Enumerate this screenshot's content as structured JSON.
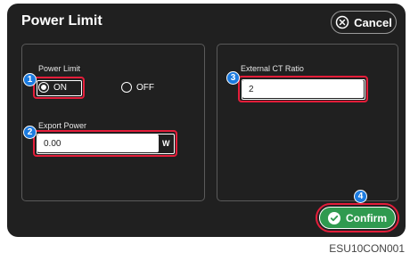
{
  "header": {
    "title": "Power Limit",
    "cancel_label": "Cancel"
  },
  "power_limit": {
    "label": "Power Limit",
    "options": [
      {
        "label": "ON",
        "selected": true
      },
      {
        "label": "OFF",
        "selected": false
      }
    ]
  },
  "export_power": {
    "label": "Export Power",
    "value": "0.00",
    "unit": "W"
  },
  "ct_ratio": {
    "label": "External CT Ratio",
    "value": "2"
  },
  "confirm_label": "Confirm",
  "callouts": [
    "1",
    "2",
    "3",
    "4"
  ],
  "caption": "ESU10CON001",
  "colors": {
    "screen_bg": "#202020",
    "highlight": "#e41d3a",
    "callout": "#1b7be0",
    "confirm": "#2f9a4f"
  },
  "icons": {
    "cancel": "close-circle-icon",
    "confirm": "check-circle-icon"
  }
}
